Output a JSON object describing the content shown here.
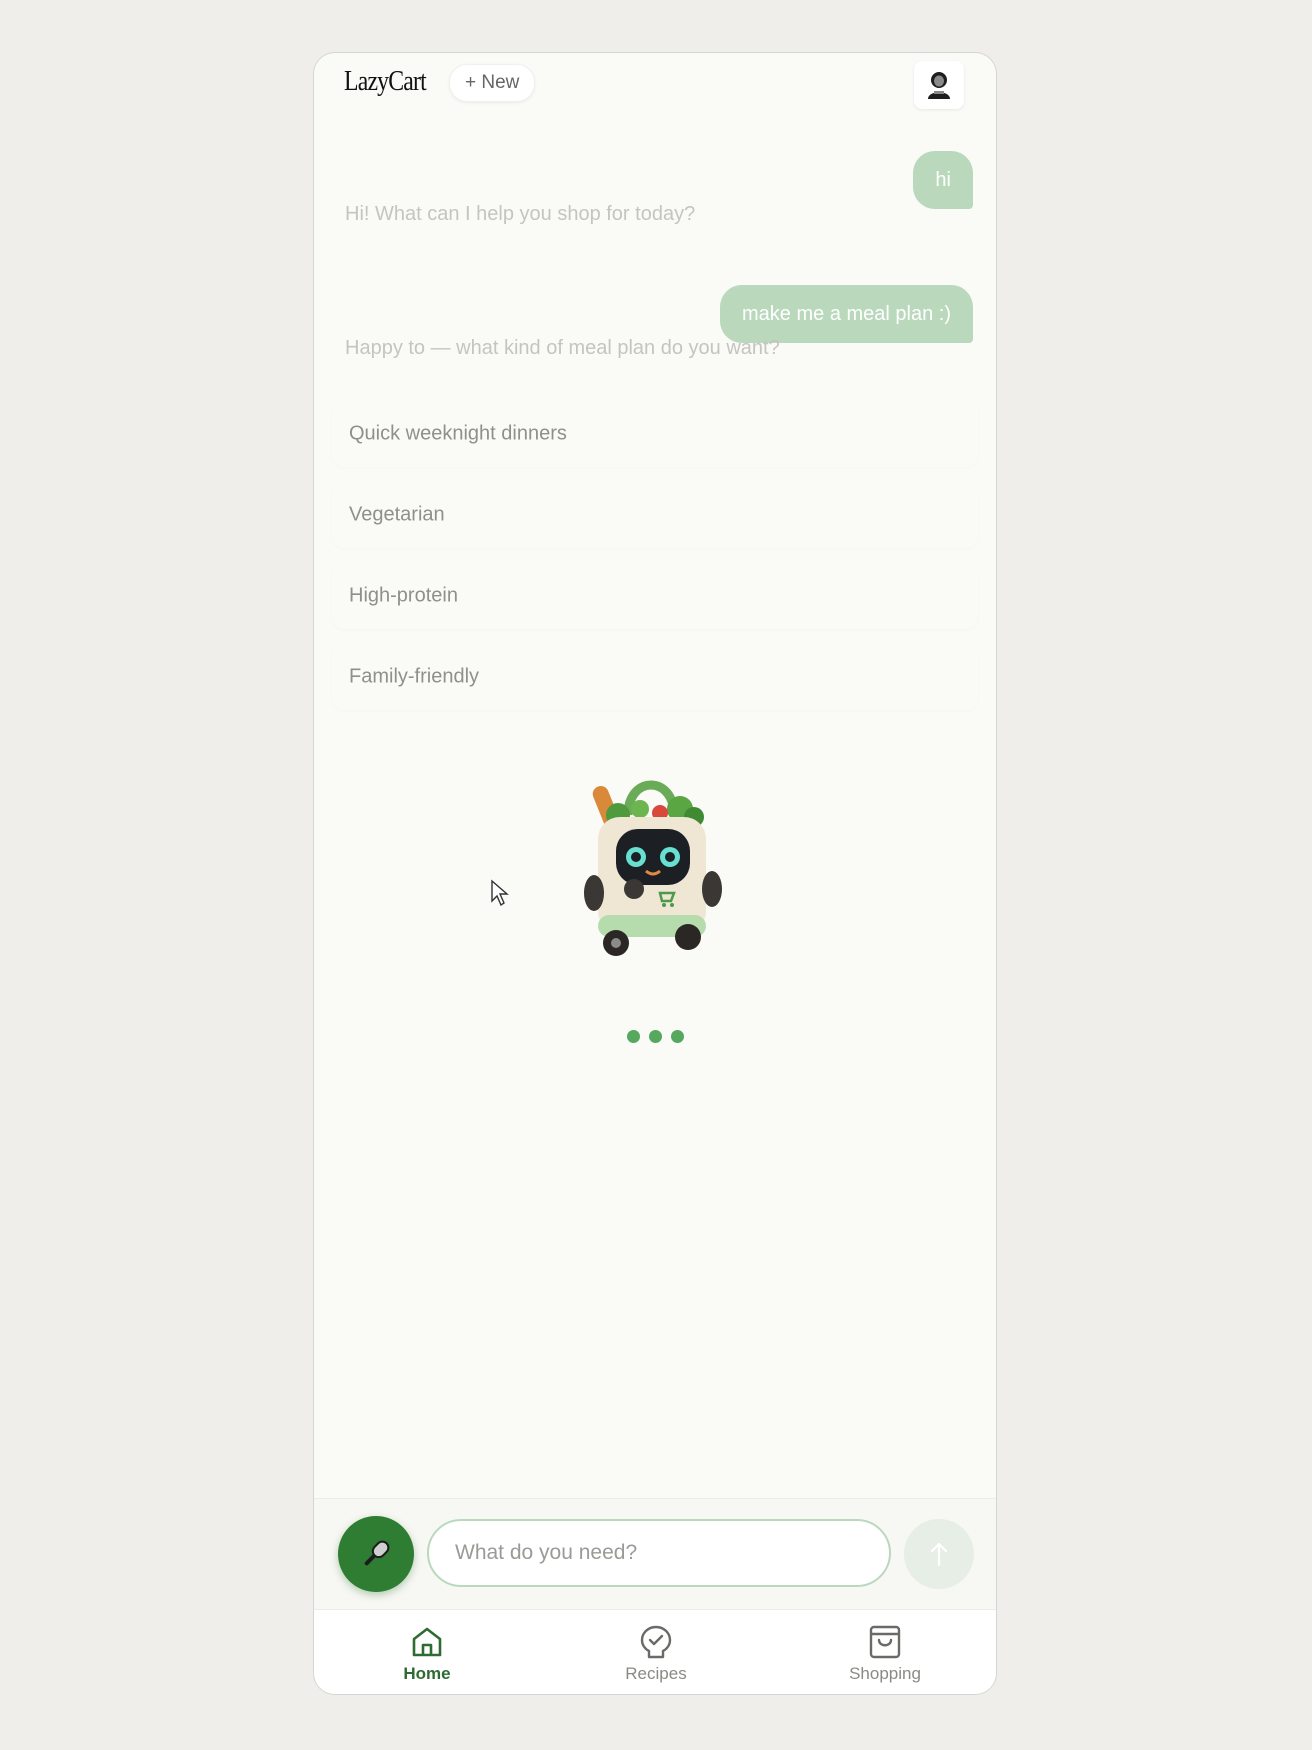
{
  "header": {
    "logo": "LazyCart",
    "new_button": "+ New"
  },
  "chat": {
    "messages": [
      {
        "role": "user",
        "text": "hi"
      },
      {
        "role": "assistant",
        "text": "Hi! What can I help you shop for today?"
      },
      {
        "role": "user",
        "text": "make me a meal plan :)"
      },
      {
        "role": "assistant",
        "text": "Happy to — what kind of meal plan do you want?"
      }
    ],
    "options": [
      "Quick weeknight dinners",
      "Vegetarian",
      "High-protein",
      "Family-friendly"
    ]
  },
  "composer": {
    "placeholder": "What do you need?",
    "mic_icon": "microphone-icon",
    "send_icon": "arrow-up-icon"
  },
  "nav": {
    "items": [
      {
        "label": "Home",
        "icon": "home-icon",
        "active": true
      },
      {
        "label": "Recipes",
        "icon": "recipes-icon",
        "active": false
      },
      {
        "label": "Shopping",
        "icon": "shopping-bag-icon",
        "active": false
      }
    ]
  },
  "colors": {
    "accent": "#2e7d32",
    "user_bubble": "#b9d8bc",
    "typing_dot": "#55a85d"
  }
}
